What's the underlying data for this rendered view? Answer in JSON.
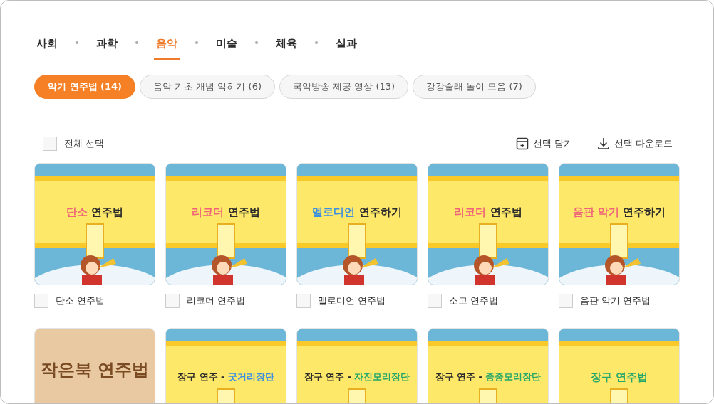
{
  "subjects": [
    {
      "label": "사회",
      "selected": false
    },
    {
      "label": "과학",
      "selected": false
    },
    {
      "label": "음악",
      "selected": true
    },
    {
      "label": "미술",
      "selected": false
    },
    {
      "label": "체육",
      "selected": false
    },
    {
      "label": "실과",
      "selected": false
    }
  ],
  "categories": [
    {
      "label": "악기 연주법 (14)",
      "selected": true
    },
    {
      "label": "음악 기초 개념 익히기 (6)",
      "selected": false
    },
    {
      "label": "국악방송 제공 영상 (13)",
      "selected": false
    },
    {
      "label": "강강술래 놀이 모음 (7)",
      "selected": false
    }
  ],
  "select_all": {
    "label": "전체 선택",
    "checked": false
  },
  "actions": [
    {
      "kind": "add",
      "label": "선택 담기"
    },
    {
      "kind": "download",
      "label": "선택 다운로드"
    }
  ],
  "cards": [
    {
      "kind": "banner",
      "title": [
        {
          "text": "단소",
          "color": "#f0647a"
        },
        {
          "text": " 연주법",
          "color": "#2b2b2b"
        }
      ],
      "label": "단소 연주법",
      "checked": false
    },
    {
      "kind": "banner",
      "title": [
        {
          "text": "리코더",
          "color": "#f0647a"
        },
        {
          "text": " 연주법",
          "color": "#2b2b2b"
        }
      ],
      "label": "리코더 연주법",
      "checked": false
    },
    {
      "kind": "banner",
      "title": [
        {
          "text": "멜로디언",
          "color": "#3d8fe0"
        },
        {
          "text": " 연주하기",
          "color": "#2b2b2b"
        }
      ],
      "label": "멜로디언 연주법",
      "checked": false
    },
    {
      "kind": "banner",
      "title": [
        {
          "text": "리코더",
          "color": "#f0647a"
        },
        {
          "text": " 연주법",
          "color": "#2b2b2b"
        }
      ],
      "label": "소고 연주법",
      "checked": false
    },
    {
      "kind": "banner",
      "title": [
        {
          "text": "음판 악기",
          "color": "#f0647a"
        },
        {
          "text": " 연주하기",
          "color": "#2b2b2b"
        }
      ],
      "label": "음판 악기 연주법",
      "checked": false
    },
    {
      "kind": "plain",
      "title": [
        {
          "text": "작은북 연주법",
          "color": "#7a4a22"
        }
      ]
    },
    {
      "kind": "banner",
      "title": [
        {
          "text": "장구 연주 - ",
          "color": "#2b2b2b"
        },
        {
          "text": "굿거리장단",
          "color": "#3d8fe0"
        }
      ]
    },
    {
      "kind": "banner",
      "title": [
        {
          "text": "장구 연주 - ",
          "color": "#2b2b2b"
        },
        {
          "text": "자진모리장단",
          "color": "#27a86a"
        }
      ]
    },
    {
      "kind": "banner",
      "title": [
        {
          "text": "장구 연주 - ",
          "color": "#2b2b2b"
        },
        {
          "text": "중중모리장단",
          "color": "#27a86a"
        }
      ]
    },
    {
      "kind": "banner",
      "title": [
        {
          "text": "장구 연주법",
          "color": "#27a86a"
        }
      ]
    }
  ]
}
